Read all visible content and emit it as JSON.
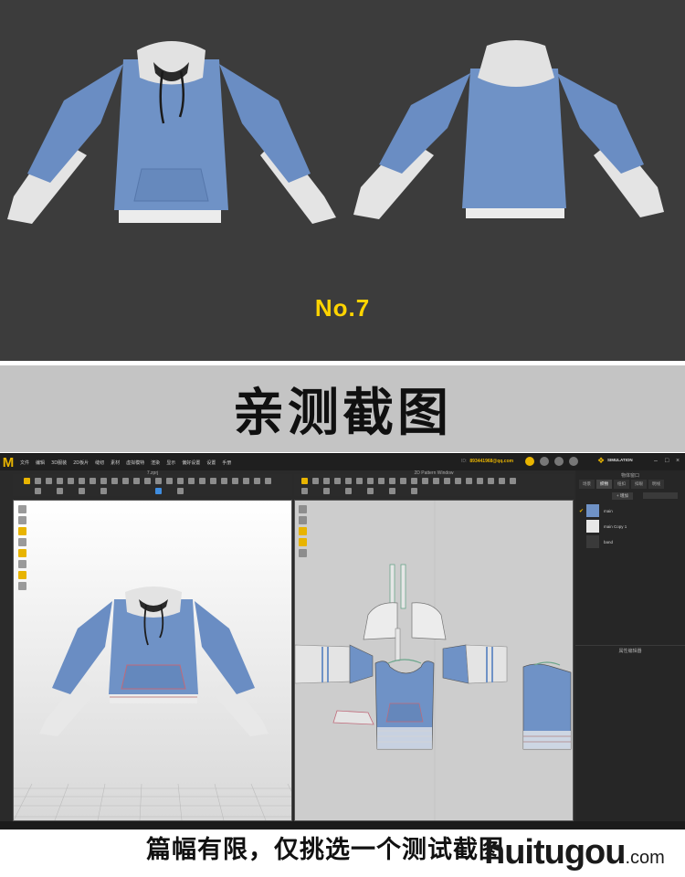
{
  "showcase": {
    "badge": "No.7",
    "hoodie_color": "#6f92c6",
    "sleeve_color": "#e4e4e4",
    "background": "#3c3c3c"
  },
  "banner": {
    "title": "亲测截图"
  },
  "app": {
    "menu": [
      "文件",
      "编辑",
      "3D服装",
      "2D板片",
      "缝纫",
      "素材",
      "虚拟模特",
      "渲染",
      "显示",
      "偏好设置",
      "设置",
      "手册"
    ],
    "account_prefix": "ID:",
    "account": "893441968@qq.com",
    "simulation_label": "SIMULATION",
    "viewport_3d_title": "7.zprj",
    "viewport_2d_title": "2D Pattern Window",
    "right_panel": {
      "title": "物体窗口",
      "tabs": [
        "场景",
        "织物",
        "纽扣",
        "扣眼",
        "明线"
      ],
      "active_tab": "织物",
      "add_button": "+ 增加",
      "fabrics": [
        {
          "name": "main",
          "color": "#6f92c6",
          "selected": true
        },
        {
          "name": "main Copy 1",
          "color": "#e8e8e8",
          "selected": false
        },
        {
          "name": "band",
          "color": "#3a3a3a",
          "selected": false
        }
      ],
      "property_title": "属性编辑器"
    }
  },
  "footer": {
    "caption": "篇幅有限，仅挑选一个测试截图",
    "watermark": "huitugou",
    "watermark_suffix": ".com"
  }
}
